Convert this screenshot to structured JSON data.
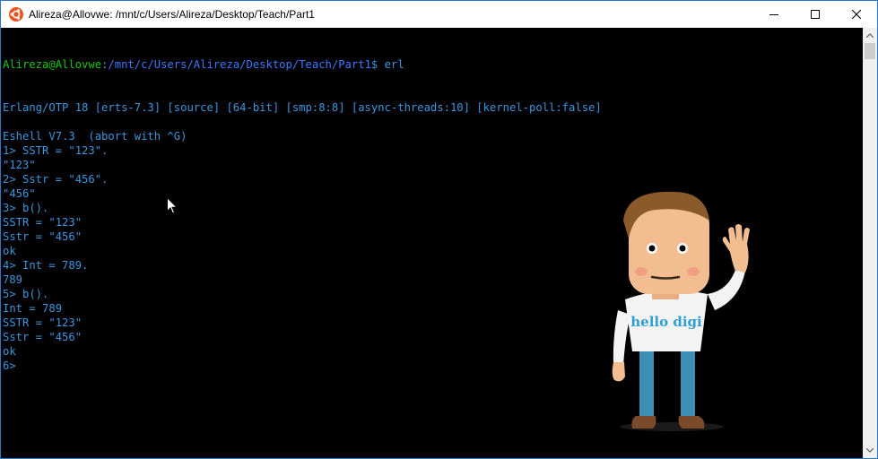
{
  "window": {
    "title": "Alireza@Allovwe: /mnt/c/Users/Alireza/Desktop/Teach/Part1",
    "app_icon": "ubuntu-icon",
    "controls": {
      "minimize": "minimize-icon",
      "maximize": "maximize-icon",
      "close": "close-icon"
    }
  },
  "terminal": {
    "prompt": {
      "user": "Alireza@Allovwe",
      "sep": ":",
      "path": "/mnt/c/Users/Alireza/Desktop/Teach/Part1",
      "suffix": "$ erl"
    },
    "lines": [
      "Erlang/OTP 18 [erts-7.3] [source] [64-bit] [smp:8:8] [async-threads:10] [kernel-poll:false]",
      "",
      "Eshell V7.3  (abort with ^G)",
      "1> SSTR = \"123\".",
      "\"123\"",
      "2> Sstr = \"456\".",
      "\"456\"",
      "3> b().",
      "SSTR = \"123\"",
      "Sstr = \"456\"",
      "ok",
      "4> Int = 789.",
      "789",
      "5> b().",
      "Int = 789",
      "SSTR = \"123\"",
      "Sstr = \"456\"",
      "ok",
      "6>"
    ],
    "colors": {
      "text": "#3a96dd",
      "user": "#16c60c",
      "path": "#3b78ff",
      "background": "#000000"
    }
  },
  "mascot": {
    "shirt_text": "hello digi"
  }
}
